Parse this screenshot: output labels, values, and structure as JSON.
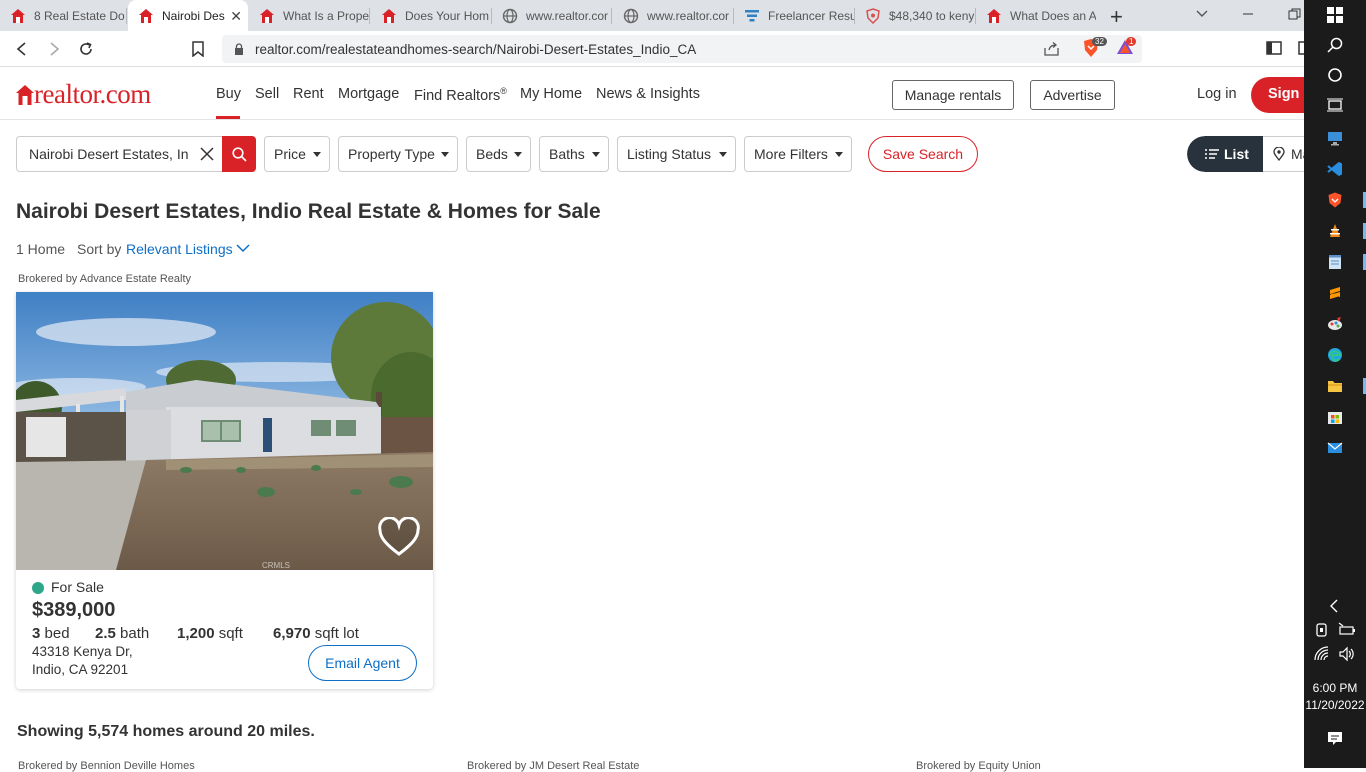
{
  "browser": {
    "tabs": [
      {
        "title": "8 Real Estate Do",
        "icon": "realtor-favicon"
      },
      {
        "title": "Nairobi Des",
        "icon": "realtor-favicon",
        "active": true
      },
      {
        "title": "What Is a Prope",
        "icon": "realtor-favicon"
      },
      {
        "title": "Does Your Hom",
        "icon": "realtor-favicon"
      },
      {
        "title": "www.realtor.cor",
        "icon": "globe-icon"
      },
      {
        "title": "www.realtor.cor",
        "icon": "globe-icon"
      },
      {
        "title": "Freelancer Resu",
        "icon": "freelancer-favicon"
      },
      {
        "title": "$48,340 to keny",
        "icon": "brave-shield-favicon"
      },
      {
        "title": "What Does an A",
        "icon": "realtor-favicon"
      }
    ],
    "url": "realtor.com/realestateandhomes-search/Nairobi-Desert-Estates_Indio_CA",
    "brave_shield_count": "32",
    "rewards_badge": "1"
  },
  "header": {
    "logo_text": "realtor.com",
    "nav": [
      "Buy",
      "Sell",
      "Rent",
      "Mortgage",
      "Find Realtors",
      "My Home",
      "News & Insights"
    ],
    "find_realtors_mark": "®",
    "manage_rentals": "Manage rentals",
    "advertise": "Advertise",
    "login": "Log in",
    "signup": "Sign up"
  },
  "filters": {
    "search_value": "Nairobi Desert Estates, In",
    "items": [
      "Price",
      "Property Type",
      "Beds",
      "Baths",
      "Listing Status",
      "More Filters"
    ],
    "save_search": "Save Search",
    "list_view": "List",
    "map_view": "Map"
  },
  "page": {
    "title": "Nairobi Desert Estates, Indio Real Estate & Homes for Sale",
    "home_count": "1 Home",
    "sort_label": "Sort by",
    "sort_value": "Relevant Listings",
    "showing": "Showing 5,574 homes around 20 miles.",
    "more_brokers": [
      "Brokered by Bennion Deville Homes",
      "Brokered by  JM Desert Real Estate",
      "Brokered by Equity Union"
    ]
  },
  "listing": {
    "broker": "Brokered by Advance Estate Realty",
    "photo_watermark": "CRMLS",
    "status": "For Sale",
    "price": "$389,000",
    "beds_num": "3",
    "beds_unit": "bed",
    "baths_num": "2.5",
    "baths_unit": "bath",
    "sqft_num": "1,200",
    "sqft_unit": "sqft",
    "lot_num": "6,970",
    "lot_unit": "sqft lot",
    "address_line1": "43318 Kenya Dr,",
    "address_line2": "Indio, CA 92201",
    "email_agent": "Email Agent"
  },
  "taskbar": {
    "time": "6:00 PM",
    "date": "11/20/2022"
  },
  "colors": {
    "brand_red": "#d92228",
    "link_blue": "#0e6fc7",
    "for_sale_green": "#2ea68a"
  }
}
